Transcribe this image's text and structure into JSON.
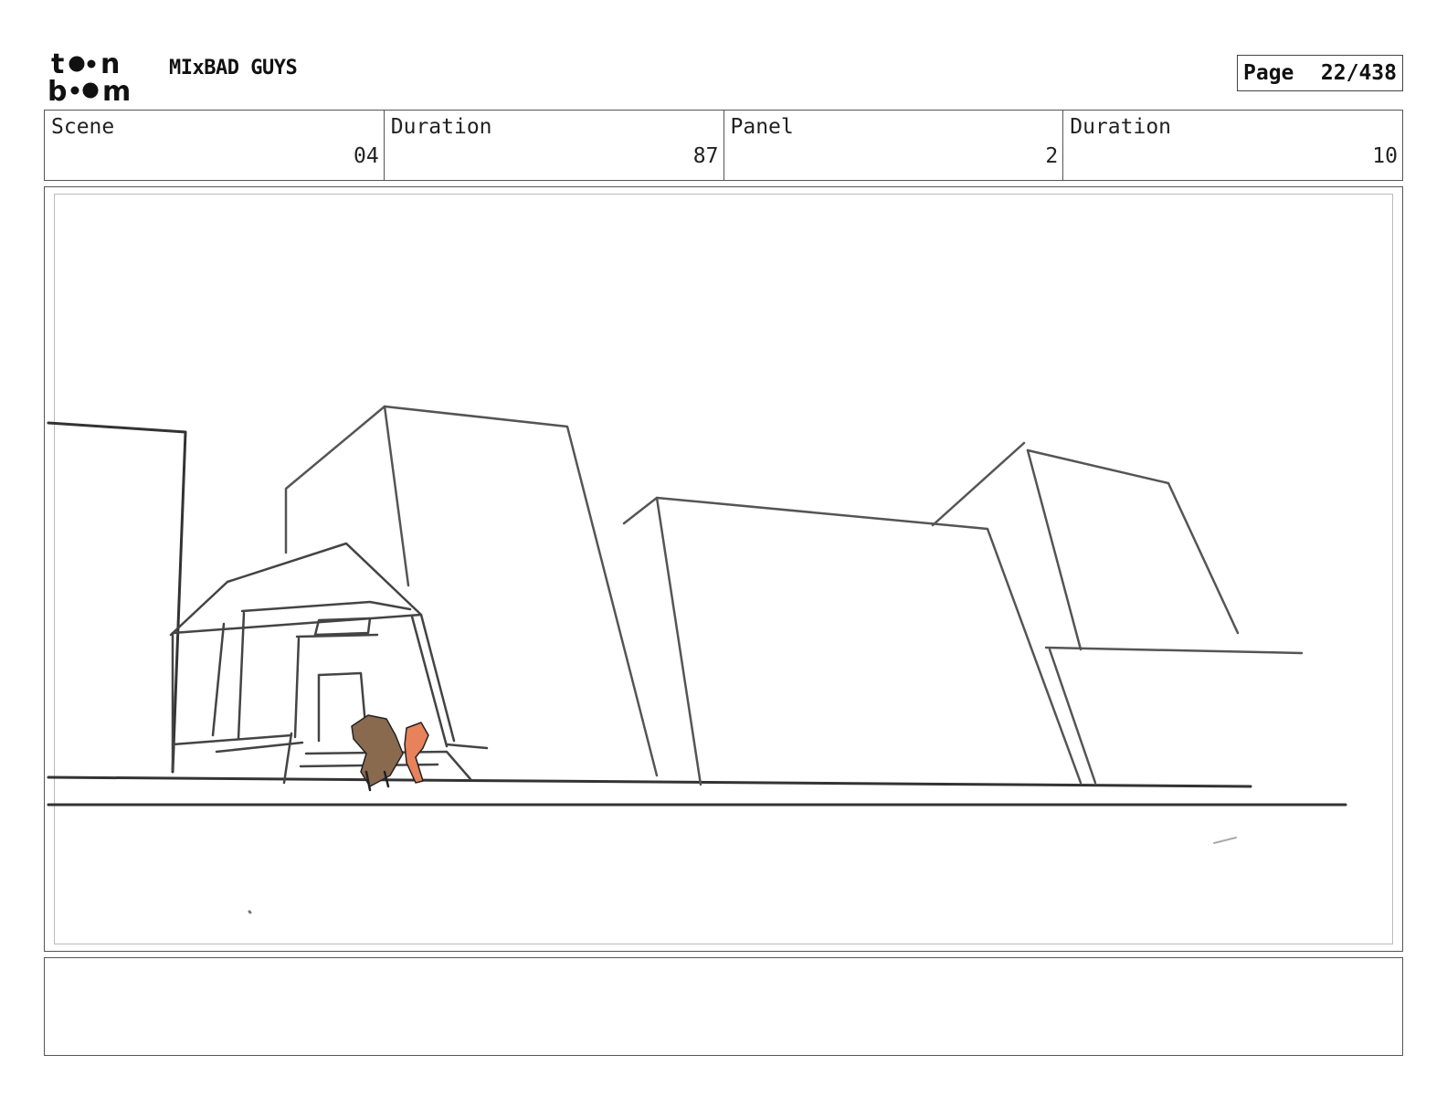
{
  "header": {
    "logo_text": "toon boom",
    "project_title": "MIxBAD GUYS",
    "page_label": "Page",
    "page_number": "22/438"
  },
  "info": {
    "scene_label": "Scene",
    "scene_value": "04",
    "scene_duration_label": "Duration",
    "scene_duration_value": "87",
    "panel_label": "Panel",
    "panel_value": "2",
    "panel_duration_label": "Duration",
    "panel_duration_value": "10"
  },
  "caption": {
    "text": ""
  },
  "colors": {
    "sketch_dark": "#333333",
    "sketch_gray": "#777777",
    "character_brown": "#8a6a4f",
    "character_orange": "#e8825a"
  }
}
